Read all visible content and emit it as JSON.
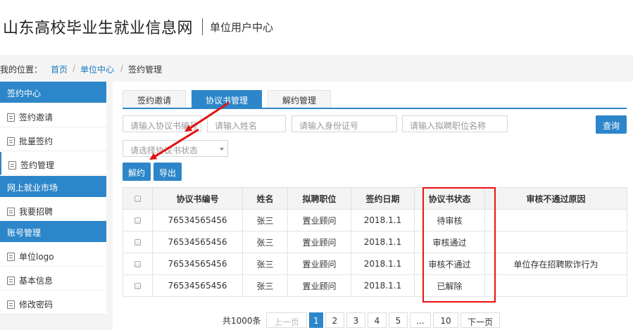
{
  "header": {
    "site_title": "山东高校毕业生就业信息网",
    "sub_title": "单位用户中心"
  },
  "breadcrumb": {
    "label": "我的位置：",
    "items": [
      "首页",
      "单位中心",
      "签约管理"
    ],
    "separator": "/"
  },
  "sidebar": {
    "sections": [
      {
        "title": "签约中心",
        "items": [
          "签约邀请",
          "批量签约",
          "签约管理"
        ]
      },
      {
        "title": "网上就业市场",
        "items": [
          "我要招聘"
        ]
      },
      {
        "title": "账号管理",
        "items": [
          "单位logo",
          "基本信息",
          "修改密码"
        ]
      }
    ],
    "active_item": "签约管理"
  },
  "tabs": [
    {
      "label": "签约邀请",
      "active": false
    },
    {
      "label": "协议书管理",
      "active": true
    },
    {
      "label": "解约管理",
      "active": false
    }
  ],
  "filters": {
    "agreement_no_placeholder": "请输入协议书编号",
    "name_placeholder": "请输入姓名",
    "id_placeholder": "请输入身份证号",
    "position_placeholder": "请输入拟聘职位名称",
    "status_placeholder": "请选择协议书状态",
    "query_label": "查询"
  },
  "actions": {
    "terminate_label": "解约",
    "export_label": "导出"
  },
  "table": {
    "columns": [
      "协议书编号",
      "姓名",
      "拟聘职位",
      "签约日期",
      "协议书状态",
      "审核不通过原因"
    ],
    "rows": [
      [
        "76534565456",
        "张三",
        "置业顾问",
        "2018.1.1",
        "待审核",
        ""
      ],
      [
        "76534565456",
        "张三",
        "置业顾问",
        "2018.1.1",
        "审核通过",
        ""
      ],
      [
        "76534565456",
        "张三",
        "置业顾问",
        "2018.1.1",
        "审核不通过",
        "单位存在招聘欺诈行为"
      ],
      [
        "76534565456",
        "张三",
        "置业顾问",
        "2018.1.1",
        "已解除",
        ""
      ]
    ]
  },
  "pagination": {
    "total": "共1000条",
    "prev": "上一页",
    "pages": [
      "1",
      "2",
      "3",
      "4",
      "5",
      "...",
      "10"
    ],
    "current": "1",
    "next": "下一页"
  },
  "colors": {
    "accent": "#2d86c9",
    "highlight": "#e11111",
    "link": "#1a7ac2"
  }
}
